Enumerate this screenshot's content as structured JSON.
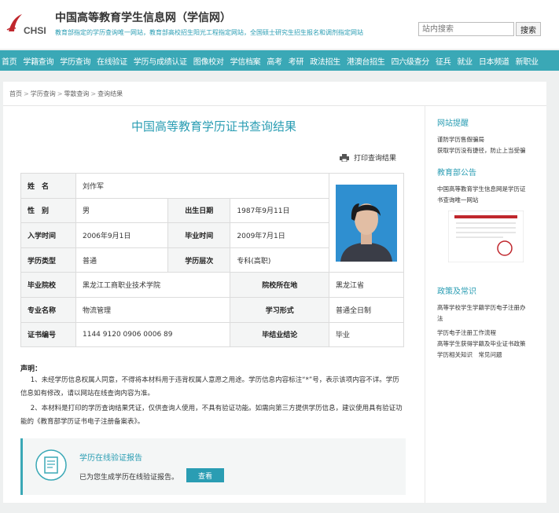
{
  "header": {
    "logo_text": "CHSI",
    "site_title": "中国高等教育学生信息网（学信网）",
    "site_subtitle": "教育部指定的学历查询唯一网站，教育部高校招生阳光工程指定网站，全国硕士研究生招生报名和调剂指定网站",
    "search_placeholder": "站内搜索",
    "search_button": "搜索"
  },
  "nav": [
    "首页",
    "学籍查询",
    "学历查询",
    "在线验证",
    "学历与成绩认证",
    "图像校对",
    "学信档案",
    "高考",
    "考研",
    "政法招生",
    "港澳台招生",
    "四六级查分",
    "征兵",
    "就业",
    "日本频道",
    "新职业"
  ],
  "breadcrumb": [
    "首页",
    "学历查询",
    "零散查询",
    "查询结果"
  ],
  "main": {
    "title": "中国高等教育学历证书查询结果",
    "print_label": "打印查询结果"
  },
  "record": {
    "name_label": "姓　名",
    "name": "刘作军",
    "gender_label": "性　别",
    "gender": "男",
    "birth_label": "出生日期",
    "birth": "1987年9月11日",
    "enroll_label": "入学时间",
    "enroll": "2006年9月1日",
    "grad_label": "毕业时间",
    "grad": "2009年7月1日",
    "type_label": "学历类型",
    "type": "普通",
    "level_label": "学历层次",
    "level": "专科(高职)",
    "school_label": "毕业院校",
    "school": "黑龙江工商职业技术学院",
    "location_label": "院校所在地",
    "location": "黑龙江省",
    "major_label": "专业名称",
    "major": "物流管理",
    "form_label": "学习形式",
    "form": "普通全日制",
    "cert_label": "证书编号",
    "cert": "1144 9120 0906 0006 89",
    "conclusion_label": "毕结业结论",
    "conclusion": "毕业"
  },
  "notice": {
    "title": "声明：",
    "p1": "1、未经学历信息权属人同意，不得将本材料用于违背权属人意愿之用途。学历信息内容标注“*”号，表示该项内容不详。学历信息如有修改，请以网站在线查询内容为准。",
    "p2": "2、本材料是打印的学历查询结果凭证，仅供查询人使用，不具有验证功能。如需向第三方提供学历信息，建议使用具有验证功能的《教育部学历证书电子注册备案表》。"
  },
  "verify": {
    "title": "学历在线验证报告",
    "desc": "已为您生成学历在线验证报告。",
    "button": "查看"
  },
  "sidebar": {
    "s1_title": "网站提醒",
    "s1_items": [
      "谨防学历售假骗局",
      "获取学历没有捷径，防止上当受骗"
    ],
    "s2_title": "教育部公告",
    "s2_items": [
      "中国高等教育学生信息网是学历证",
      "书查询唯一网站"
    ],
    "s3_title": "政策及常识",
    "s3_items": [
      "高等学校学生学籍学历电子注册办",
      "法",
      "学历电子注册工作流程",
      "高等学生获得学籍及毕业证书政策",
      "学历相关知识　常见问题"
    ]
  },
  "colors": {
    "accent": "#3aa8b6",
    "accent_text": "#2a9db3",
    "logo_red": "#c0272d"
  }
}
